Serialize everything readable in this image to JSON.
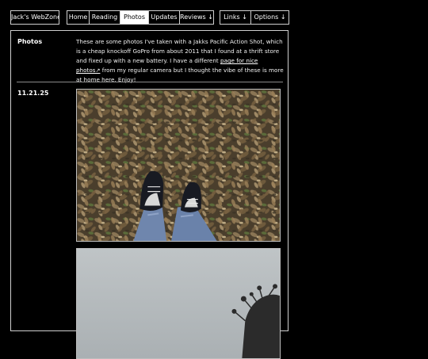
{
  "nav": {
    "home_site": "Jack's WebZone",
    "home": "Home",
    "reading": "Reading",
    "photos": "Photos",
    "updates": "Updates",
    "reviews": "Reviews ↓",
    "links": "Links ↓",
    "options": "Options ↓"
  },
  "page": {
    "section_label": "Photos",
    "intro_before": "These are some photos I've taken with a Jakks Pacific Action Shot, which is a cheap knockoff GoPro from about 2011 that I found at a thrift store and fixed up with a new battery. I have a different ",
    "intro_link": "page for nice photos↗",
    "intro_after": " from my regular camera but I thought the vibe of these is more at home here. Enjoy!",
    "entries": [
      {
        "date": "11.21.25"
      }
    ]
  },
  "colors": {
    "background": "#000000",
    "border": "#cfcfcf",
    "active_tab_bg": "#ffffff"
  }
}
